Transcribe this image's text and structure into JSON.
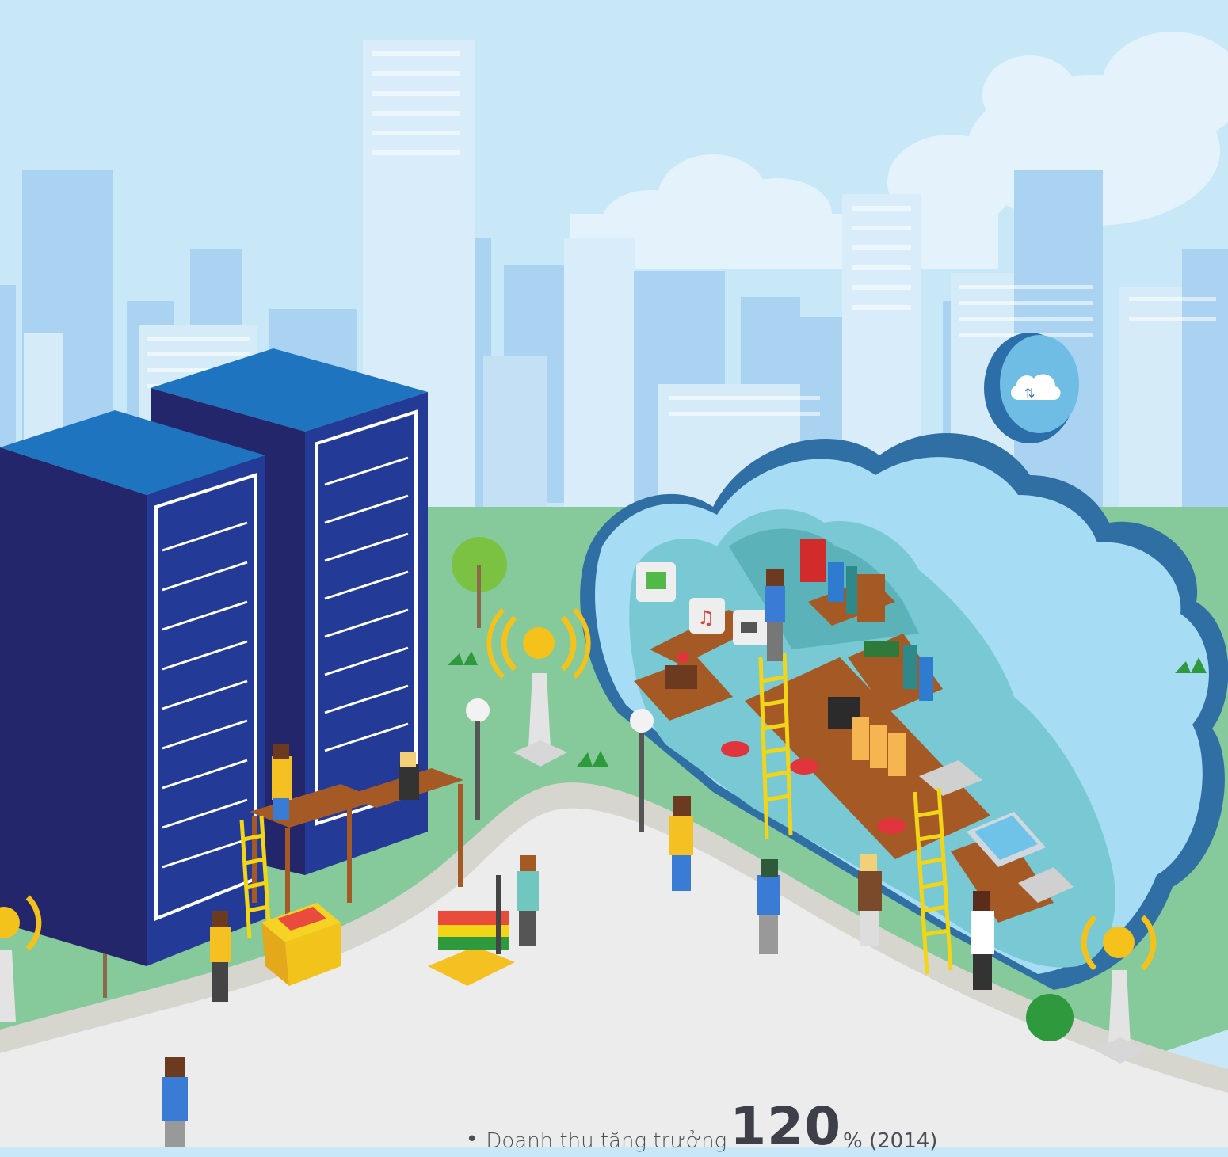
{
  "caption": {
    "bullet": "•",
    "prefix": "Doanh thu tăng trưởng",
    "value": "120",
    "suffix": "% (2014)"
  },
  "colors": {
    "sky": "#c9e8f7",
    "building_light": "#d9ecfa",
    "building_mid": "#aad3f1",
    "grass": "#86c99a",
    "road": "#ececec",
    "road_edge": "#d6d6cf",
    "server_front": "#2a2d74",
    "server_top": "#1f74bf",
    "server_side": "#233a96",
    "cloud_outline": "#2f6fa4",
    "cloud_fill": "#a7dcf5",
    "cloud_inner": "#78c9d3",
    "ladder": "#f2d517",
    "shelf": "#a55a26",
    "signal": "#f4c21a",
    "tree": "#7cc242"
  },
  "icons": {
    "cloud_sync": "cloud-sync-icon",
    "wifi_signal": "wifi-signal-icon",
    "music": "music-note-icon",
    "image": "image-icon",
    "video": "video-camera-icon",
    "cd": "cd-disc-icon",
    "folder": "folder-icon",
    "clapper": "clapperboard-icon"
  }
}
